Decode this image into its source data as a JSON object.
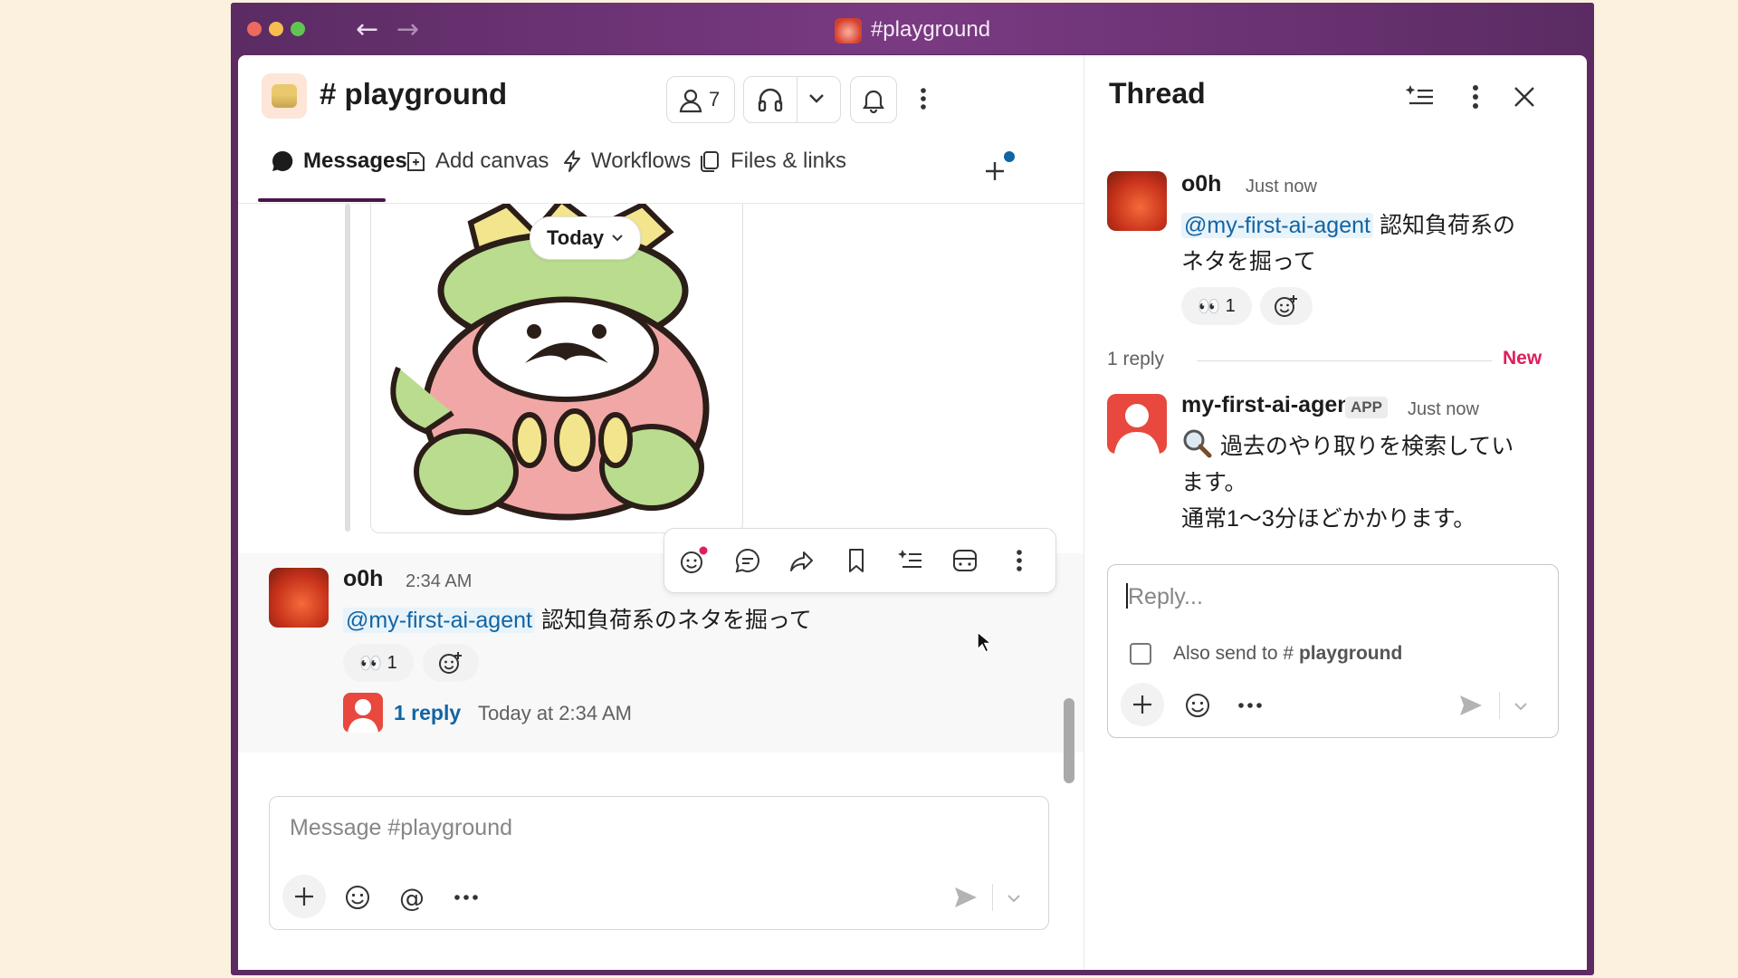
{
  "window": {
    "title": "#playground"
  },
  "channel": {
    "hash": "#",
    "name": "playground",
    "member_count": "7"
  },
  "tabs": [
    {
      "label": "Messages"
    },
    {
      "label": "Add canvas"
    },
    {
      "label": "Workflows"
    },
    {
      "label": "Files & links"
    }
  ],
  "today_pill": {
    "label": "Today"
  },
  "message": {
    "author": "o0h",
    "time": "2:34 AM",
    "mention": "@my-first-ai-agent",
    "text": "認知負荷系のネタを掘って",
    "reaction_emoji": "👀",
    "reaction_count": "1",
    "reply_link": "1 reply",
    "reply_time": "Today at 2:34 AM"
  },
  "composer": {
    "placeholder": "Message #playground"
  },
  "thread": {
    "title": "Thread",
    "parent": {
      "author": "o0h",
      "time": "Just now",
      "mention": "@my-first-ai-agent",
      "text_line1": "認知負荷系の",
      "text_line2": "ネタを掘って",
      "reaction_emoji": "👀",
      "reaction_count": "1"
    },
    "reply_count_label": "1 reply",
    "new_label": "New",
    "reply": {
      "author": "my-first-ai-agent",
      "badge": "APP",
      "time": "Just now",
      "line1": "過去のやり取りを検索してい",
      "line2": "ます。",
      "line3": "通常1〜3分ほどかかります。"
    },
    "reply_box": {
      "placeholder": "Reply...",
      "also_send_prefix": "Also send to",
      "also_send_hash": "#",
      "also_send_channel": "playground"
    }
  },
  "colors": {
    "window_chrome": "#5d2a64",
    "mention_text": "#1264a3",
    "new_label": "#e01e5a",
    "link": "#1264a3",
    "active_tab_underline": "#4a154b"
  }
}
